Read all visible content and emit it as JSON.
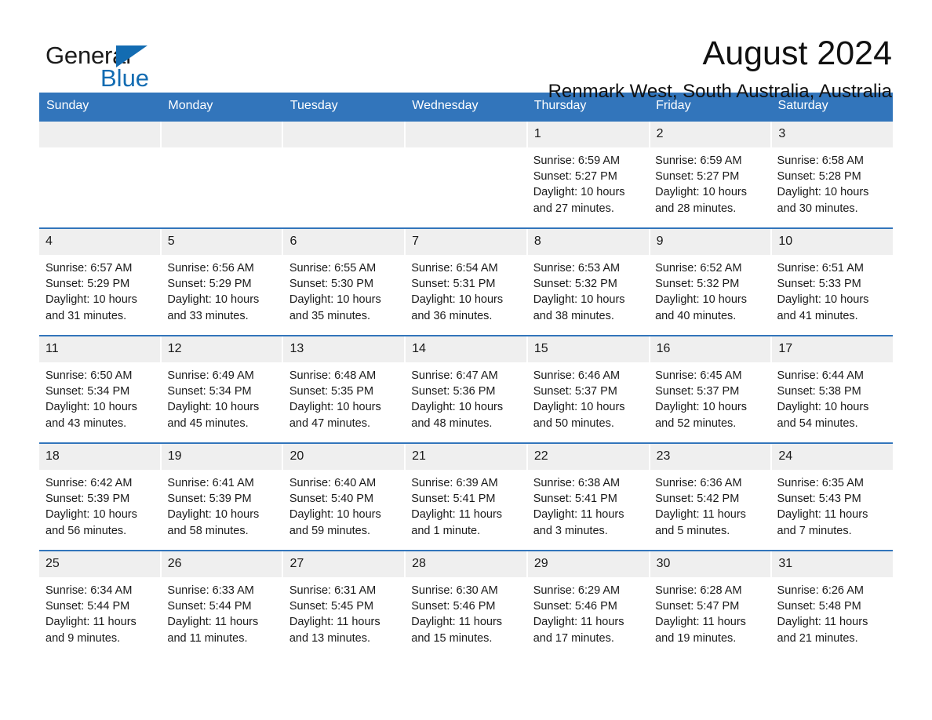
{
  "logo": {
    "word_one": "General",
    "word_two": "Blue",
    "triangle_icon": "triangle-icon",
    "accent_color": "#136cb2"
  },
  "header": {
    "title": "August 2024",
    "location": "Renmark West, South Australia, Australia"
  },
  "theme": {
    "header_blue": "#3275bb",
    "date_band_gray": "#efefef",
    "text_color": "#1a1a1a"
  },
  "calendar": {
    "weekdays": [
      "Sunday",
      "Monday",
      "Tuesday",
      "Wednesday",
      "Thursday",
      "Friday",
      "Saturday"
    ],
    "weeks": [
      {
        "days": [
          {
            "date": "",
            "empty": true,
            "sunrise": "",
            "sunset": "",
            "daylight_line1": "",
            "daylight_line2": ""
          },
          {
            "date": "",
            "empty": true,
            "sunrise": "",
            "sunset": "",
            "daylight_line1": "",
            "daylight_line2": ""
          },
          {
            "date": "",
            "empty": true,
            "sunrise": "",
            "sunset": "",
            "daylight_line1": "",
            "daylight_line2": ""
          },
          {
            "date": "",
            "empty": true,
            "sunrise": "",
            "sunset": "",
            "daylight_line1": "",
            "daylight_line2": ""
          },
          {
            "date": "1",
            "empty": false,
            "sunrise": "Sunrise: 6:59 AM",
            "sunset": "Sunset: 5:27 PM",
            "daylight_line1": "Daylight: 10 hours",
            "daylight_line2": "and 27 minutes."
          },
          {
            "date": "2",
            "empty": false,
            "sunrise": "Sunrise: 6:59 AM",
            "sunset": "Sunset: 5:27 PM",
            "daylight_line1": "Daylight: 10 hours",
            "daylight_line2": "and 28 minutes."
          },
          {
            "date": "3",
            "empty": false,
            "sunrise": "Sunrise: 6:58 AM",
            "sunset": "Sunset: 5:28 PM",
            "daylight_line1": "Daylight: 10 hours",
            "daylight_line2": "and 30 minutes."
          }
        ]
      },
      {
        "days": [
          {
            "date": "4",
            "empty": false,
            "sunrise": "Sunrise: 6:57 AM",
            "sunset": "Sunset: 5:29 PM",
            "daylight_line1": "Daylight: 10 hours",
            "daylight_line2": "and 31 minutes."
          },
          {
            "date": "5",
            "empty": false,
            "sunrise": "Sunrise: 6:56 AM",
            "sunset": "Sunset: 5:29 PM",
            "daylight_line1": "Daylight: 10 hours",
            "daylight_line2": "and 33 minutes."
          },
          {
            "date": "6",
            "empty": false,
            "sunrise": "Sunrise: 6:55 AM",
            "sunset": "Sunset: 5:30 PM",
            "daylight_line1": "Daylight: 10 hours",
            "daylight_line2": "and 35 minutes."
          },
          {
            "date": "7",
            "empty": false,
            "sunrise": "Sunrise: 6:54 AM",
            "sunset": "Sunset: 5:31 PM",
            "daylight_line1": "Daylight: 10 hours",
            "daylight_line2": "and 36 minutes."
          },
          {
            "date": "8",
            "empty": false,
            "sunrise": "Sunrise: 6:53 AM",
            "sunset": "Sunset: 5:32 PM",
            "daylight_line1": "Daylight: 10 hours",
            "daylight_line2": "and 38 minutes."
          },
          {
            "date": "9",
            "empty": false,
            "sunrise": "Sunrise: 6:52 AM",
            "sunset": "Sunset: 5:32 PM",
            "daylight_line1": "Daylight: 10 hours",
            "daylight_line2": "and 40 minutes."
          },
          {
            "date": "10",
            "empty": false,
            "sunrise": "Sunrise: 6:51 AM",
            "sunset": "Sunset: 5:33 PM",
            "daylight_line1": "Daylight: 10 hours",
            "daylight_line2": "and 41 minutes."
          }
        ]
      },
      {
        "days": [
          {
            "date": "11",
            "empty": false,
            "sunrise": "Sunrise: 6:50 AM",
            "sunset": "Sunset: 5:34 PM",
            "daylight_line1": "Daylight: 10 hours",
            "daylight_line2": "and 43 minutes."
          },
          {
            "date": "12",
            "empty": false,
            "sunrise": "Sunrise: 6:49 AM",
            "sunset": "Sunset: 5:34 PM",
            "daylight_line1": "Daylight: 10 hours",
            "daylight_line2": "and 45 minutes."
          },
          {
            "date": "13",
            "empty": false,
            "sunrise": "Sunrise: 6:48 AM",
            "sunset": "Sunset: 5:35 PM",
            "daylight_line1": "Daylight: 10 hours",
            "daylight_line2": "and 47 minutes."
          },
          {
            "date": "14",
            "empty": false,
            "sunrise": "Sunrise: 6:47 AM",
            "sunset": "Sunset: 5:36 PM",
            "daylight_line1": "Daylight: 10 hours",
            "daylight_line2": "and 48 minutes."
          },
          {
            "date": "15",
            "empty": false,
            "sunrise": "Sunrise: 6:46 AM",
            "sunset": "Sunset: 5:37 PM",
            "daylight_line1": "Daylight: 10 hours",
            "daylight_line2": "and 50 minutes."
          },
          {
            "date": "16",
            "empty": false,
            "sunrise": "Sunrise: 6:45 AM",
            "sunset": "Sunset: 5:37 PM",
            "daylight_line1": "Daylight: 10 hours",
            "daylight_line2": "and 52 minutes."
          },
          {
            "date": "17",
            "empty": false,
            "sunrise": "Sunrise: 6:44 AM",
            "sunset": "Sunset: 5:38 PM",
            "daylight_line1": "Daylight: 10 hours",
            "daylight_line2": "and 54 minutes."
          }
        ]
      },
      {
        "days": [
          {
            "date": "18",
            "empty": false,
            "sunrise": "Sunrise: 6:42 AM",
            "sunset": "Sunset: 5:39 PM",
            "daylight_line1": "Daylight: 10 hours",
            "daylight_line2": "and 56 minutes."
          },
          {
            "date": "19",
            "empty": false,
            "sunrise": "Sunrise: 6:41 AM",
            "sunset": "Sunset: 5:39 PM",
            "daylight_line1": "Daylight: 10 hours",
            "daylight_line2": "and 58 minutes."
          },
          {
            "date": "20",
            "empty": false,
            "sunrise": "Sunrise: 6:40 AM",
            "sunset": "Sunset: 5:40 PM",
            "daylight_line1": "Daylight: 10 hours",
            "daylight_line2": "and 59 minutes."
          },
          {
            "date": "21",
            "empty": false,
            "sunrise": "Sunrise: 6:39 AM",
            "sunset": "Sunset: 5:41 PM",
            "daylight_line1": "Daylight: 11 hours",
            "daylight_line2": "and 1 minute."
          },
          {
            "date": "22",
            "empty": false,
            "sunrise": "Sunrise: 6:38 AM",
            "sunset": "Sunset: 5:41 PM",
            "daylight_line1": "Daylight: 11 hours",
            "daylight_line2": "and 3 minutes."
          },
          {
            "date": "23",
            "empty": false,
            "sunrise": "Sunrise: 6:36 AM",
            "sunset": "Sunset: 5:42 PM",
            "daylight_line1": "Daylight: 11 hours",
            "daylight_line2": "and 5 minutes."
          },
          {
            "date": "24",
            "empty": false,
            "sunrise": "Sunrise: 6:35 AM",
            "sunset": "Sunset: 5:43 PM",
            "daylight_line1": "Daylight: 11 hours",
            "daylight_line2": "and 7 minutes."
          }
        ]
      },
      {
        "days": [
          {
            "date": "25",
            "empty": false,
            "sunrise": "Sunrise: 6:34 AM",
            "sunset": "Sunset: 5:44 PM",
            "daylight_line1": "Daylight: 11 hours",
            "daylight_line2": "and 9 minutes."
          },
          {
            "date": "26",
            "empty": false,
            "sunrise": "Sunrise: 6:33 AM",
            "sunset": "Sunset: 5:44 PM",
            "daylight_line1": "Daylight: 11 hours",
            "daylight_line2": "and 11 minutes."
          },
          {
            "date": "27",
            "empty": false,
            "sunrise": "Sunrise: 6:31 AM",
            "sunset": "Sunset: 5:45 PM",
            "daylight_line1": "Daylight: 11 hours",
            "daylight_line2": "and 13 minutes."
          },
          {
            "date": "28",
            "empty": false,
            "sunrise": "Sunrise: 6:30 AM",
            "sunset": "Sunset: 5:46 PM",
            "daylight_line1": "Daylight: 11 hours",
            "daylight_line2": "and 15 minutes."
          },
          {
            "date": "29",
            "empty": false,
            "sunrise": "Sunrise: 6:29 AM",
            "sunset": "Sunset: 5:46 PM",
            "daylight_line1": "Daylight: 11 hours",
            "daylight_line2": "and 17 minutes."
          },
          {
            "date": "30",
            "empty": false,
            "sunrise": "Sunrise: 6:28 AM",
            "sunset": "Sunset: 5:47 PM",
            "daylight_line1": "Daylight: 11 hours",
            "daylight_line2": "and 19 minutes."
          },
          {
            "date": "31",
            "empty": false,
            "sunrise": "Sunrise: 6:26 AM",
            "sunset": "Sunset: 5:48 PM",
            "daylight_line1": "Daylight: 11 hours",
            "daylight_line2": "and 21 minutes."
          }
        ]
      }
    ]
  }
}
